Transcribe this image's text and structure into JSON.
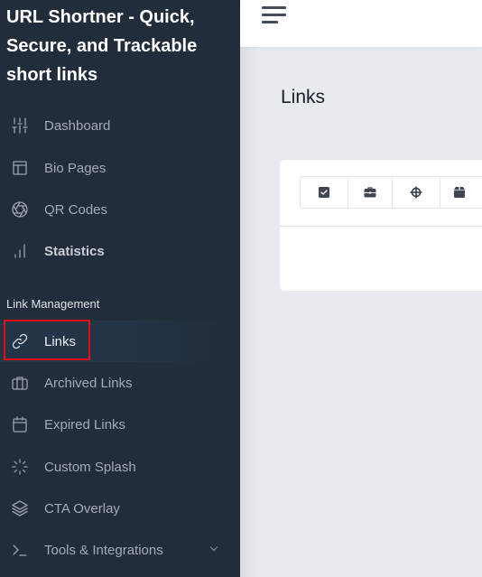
{
  "sidebar": {
    "brand_title": "URL Shortner - Quick, Secure, and Trackable short links",
    "items": [
      {
        "label": "Dashboard",
        "icon": "sliders-icon"
      },
      {
        "label": "Bio Pages",
        "icon": "layout-icon"
      },
      {
        "label": "QR Codes",
        "icon": "aperture-icon"
      },
      {
        "label": "Statistics",
        "icon": "bar-chart-icon"
      }
    ],
    "section_label": "Link Management",
    "link_items": [
      {
        "label": "Links",
        "icon": "link-icon",
        "active": true
      },
      {
        "label": "Archived Links",
        "icon": "briefcase-icon"
      },
      {
        "label": "Expired Links",
        "icon": "calendar-icon"
      },
      {
        "label": "Custom Splash",
        "icon": "loader-icon"
      },
      {
        "label": "CTA Overlay",
        "icon": "layers-icon"
      },
      {
        "label": "Tools & Integrations",
        "icon": "terminal-icon",
        "has_submenu": true
      }
    ]
  },
  "topbar": {
    "menu_icon": "hamburger-menu-icon"
  },
  "main": {
    "title": "Links",
    "toolbar_buttons": [
      {
        "name": "select-all",
        "icon": "check-square-icon"
      },
      {
        "name": "archive",
        "icon": "briefcase-icon"
      },
      {
        "name": "target",
        "icon": "crosshairs-icon"
      },
      {
        "name": "box",
        "icon": "box-icon"
      }
    ]
  },
  "colors": {
    "sidebar_bg": "#222d3b",
    "active_bg": "#253549",
    "highlight": "#e10f14",
    "content_bg": "#e7eaef",
    "icon_dark": "#3f4652"
  }
}
